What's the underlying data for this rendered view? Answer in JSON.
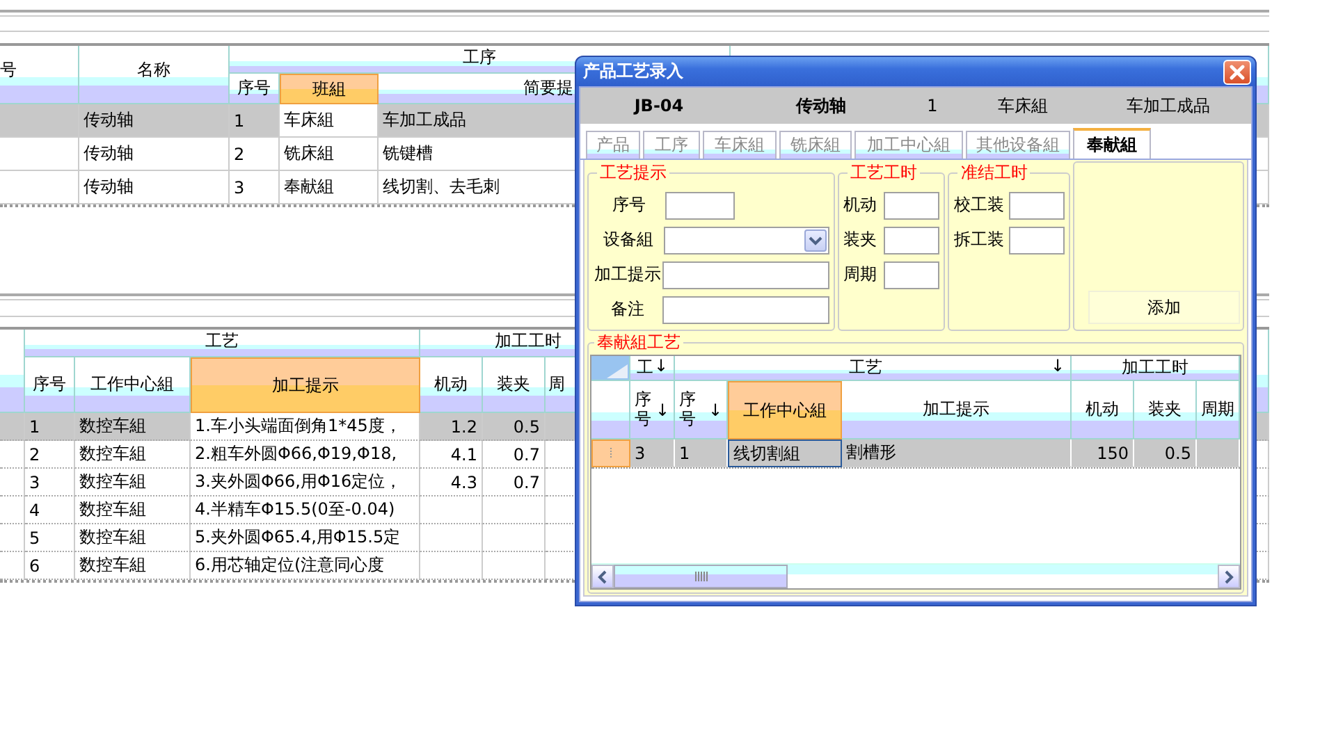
{
  "main_grid": {
    "head_columns": [
      {
        "label": "号"
      },
      {
        "label": "名称"
      }
    ],
    "groups": [
      {
        "label": "工序",
        "columns": [
          {
            "label": "序号",
            "selected": false
          },
          {
            "label": "班組",
            "selected": true
          },
          {
            "label": "简要提",
            "selected": false
          }
        ]
      }
    ],
    "rows": [
      {
        "selected": true,
        "name": "传动轴",
        "cells": [
          "1",
          "车床組",
          "车加工成品"
        ]
      },
      {
        "selected": false,
        "name": "传动轴",
        "cells": [
          "2",
          "铣床組",
          "铣键槽"
        ]
      },
      {
        "selected": false,
        "name": "传动轴",
        "cells": [
          "3",
          "奉献組",
          "线切割、去毛刺"
        ]
      }
    ]
  },
  "detail_grid": {
    "groups": [
      {
        "label": "工艺",
        "columns": [
          {
            "label": "序号",
            "kind": "text",
            "selected": false
          },
          {
            "label": "工作中心組",
            "kind": "text",
            "selected": false
          },
          {
            "label": "加工提示",
            "kind": "text",
            "selected": true
          }
        ]
      },
      {
        "label": "加工工时",
        "columns": [
          {
            "label": "机动",
            "kind": "number",
            "selected": false
          },
          {
            "label": "装夹",
            "kind": "number",
            "selected": false
          },
          {
            "label": "周",
            "kind": "number",
            "selected": false
          }
        ]
      }
    ],
    "rows": [
      {
        "selected": true,
        "cells": [
          "1",
          "数控车組",
          "1.车小头端面倒角1*45度，",
          "1.2",
          "0.5"
        ]
      },
      {
        "selected": false,
        "cells": [
          "2",
          "数控车組",
          "2.粗车外圆Φ66,Φ19,Φ18,",
          "4.1",
          "0.7"
        ]
      },
      {
        "selected": false,
        "cells": [
          "3",
          "数控车組",
          "3.夹外圆Φ66,用Φ16定位，",
          "4.3",
          "0.7"
        ]
      },
      {
        "selected": false,
        "cells": [
          "4",
          "数控车組",
          "4.半精车Φ15.5(0至-0.04)"
        ]
      },
      {
        "selected": false,
        "cells": [
          "5",
          "数控车組",
          "5.夹外圆Φ65.4,用Φ15.5定"
        ]
      },
      {
        "selected": false,
        "cells": [
          "6",
          "数控车組",
          "6.用芯轴定位(注意同心度"
        ]
      }
    ]
  },
  "dialog": {
    "title": "产品工艺录入",
    "info": [
      {
        "text": "JB-04",
        "bold": true
      },
      {
        "text": "传动轴",
        "bold": true
      },
      {
        "text": "1",
        "bold": false
      },
      {
        "text": "车床組",
        "bold": false
      },
      {
        "text": "车加工成品",
        "bold": false
      }
    ],
    "tabs": [
      {
        "label": "产品",
        "selected": false
      },
      {
        "label": "工序",
        "selected": false
      },
      {
        "label": "车床組",
        "selected": false
      },
      {
        "label": "铣床組",
        "selected": false
      },
      {
        "label": "加工中心組",
        "selected": false
      },
      {
        "label": "其他设备組",
        "selected": false
      },
      {
        "label": "奉献組",
        "selected": true
      }
    ],
    "hint_box": {
      "legend": "工艺提示",
      "fields": [
        {
          "label": "序号",
          "kind": "short"
        },
        {
          "label": "设备組",
          "kind": "dropdown"
        },
        {
          "label": "加工提示",
          "kind": "text"
        },
        {
          "label": "备注",
          "kind": "text"
        }
      ]
    },
    "time_box": {
      "legend": "工艺工时",
      "fields": [
        {
          "label": "机动"
        },
        {
          "label": "装夹"
        },
        {
          "label": "周期"
        }
      ]
    },
    "setup_box": {
      "legend": "准结工时",
      "fields": [
        {
          "label": "校工装"
        },
        {
          "label": "拆工装"
        }
      ]
    },
    "add_button": "添加",
    "process": {
      "legend": "奉献組工艺",
      "groups": [
        {
          "label": "工",
          "arrow": "↓",
          "columns": [
            {
              "label": "序号",
              "arrow": "↓",
              "kind": "text",
              "selected": false
            }
          ]
        },
        {
          "label": "工艺",
          "arrow": "↓",
          "columns": [
            {
              "label": "序号",
              "arrow": "↓",
              "kind": "text",
              "selected": false
            },
            {
              "label": "工作中心組",
              "kind": "text",
              "selected": true
            },
            {
              "label": "加工提示",
              "kind": "text",
              "selected": false
            }
          ]
        },
        {
          "label": "加工工时",
          "columns": [
            {
              "label": "机动",
              "kind": "number",
              "selected": false
            },
            {
              "label": "装夹",
              "kind": "number",
              "selected": false
            },
            {
              "label": "周期",
              "kind": "number",
              "selected": false
            }
          ]
        }
      ],
      "rows": [
        {
          "selected": true,
          "cells": [
            "3",
            "1",
            "线切割組",
            "割槽形",
            "150",
            "0.5"
          ]
        }
      ]
    }
  }
}
